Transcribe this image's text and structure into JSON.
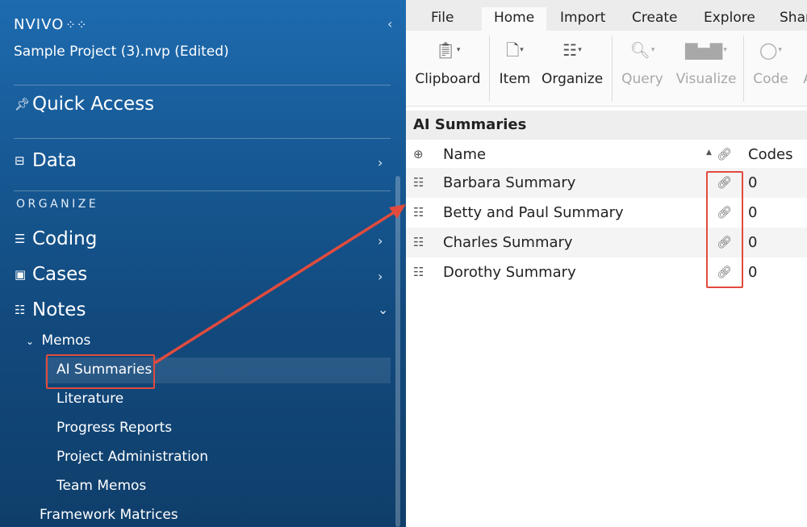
{
  "app": {
    "brand": "NVIVO",
    "brand_mark": "⁘⁘",
    "project": "Sample Project (3).nvp (Edited)"
  },
  "sidebar": {
    "quick_access": "Quick Access",
    "data": "Data",
    "section_organize": "ORGANIZE",
    "coding": "Coding",
    "cases": "Cases",
    "notes": "Notes",
    "memos": "Memos",
    "memo_items": [
      "AI Summaries",
      "Literature",
      "Progress Reports",
      "Project Administration",
      "Team Memos"
    ],
    "framework_matrices": "Framework Matrices"
  },
  "ribbon": {
    "tabs": [
      "File",
      "Home",
      "Import",
      "Create",
      "Explore",
      "Shar"
    ],
    "active_tab": "Home",
    "groups": [
      {
        "label": "Clipboard",
        "icon": "clipboard-icon",
        "enabled": true
      },
      {
        "label": "Item",
        "icon": "item-icon",
        "enabled": true
      },
      {
        "label": "Organize",
        "icon": "organize-icon",
        "enabled": true
      },
      {
        "label": "Query",
        "icon": "query-icon",
        "enabled": false
      },
      {
        "label": "Visualize",
        "icon": "visualize-icon",
        "enabled": false
      },
      {
        "label": "Code",
        "icon": "code-icon",
        "enabled": false
      },
      {
        "label": "A",
        "icon": "",
        "enabled": false
      }
    ]
  },
  "list": {
    "title": "AI Summaries",
    "columns": {
      "name": "Name",
      "codes": "Codes"
    },
    "rows": [
      {
        "name": "Barbara Summary",
        "codes": "0"
      },
      {
        "name": "Betty and Paul Summary",
        "codes": "0"
      },
      {
        "name": "Charles Summary",
        "codes": "0"
      },
      {
        "name": "Dorothy Summary",
        "codes": "0"
      }
    ]
  },
  "colors": {
    "sidebar_top": "#1e6bb0",
    "sidebar_bottom": "#0f3e6a",
    "callout": "#e04b3e"
  }
}
